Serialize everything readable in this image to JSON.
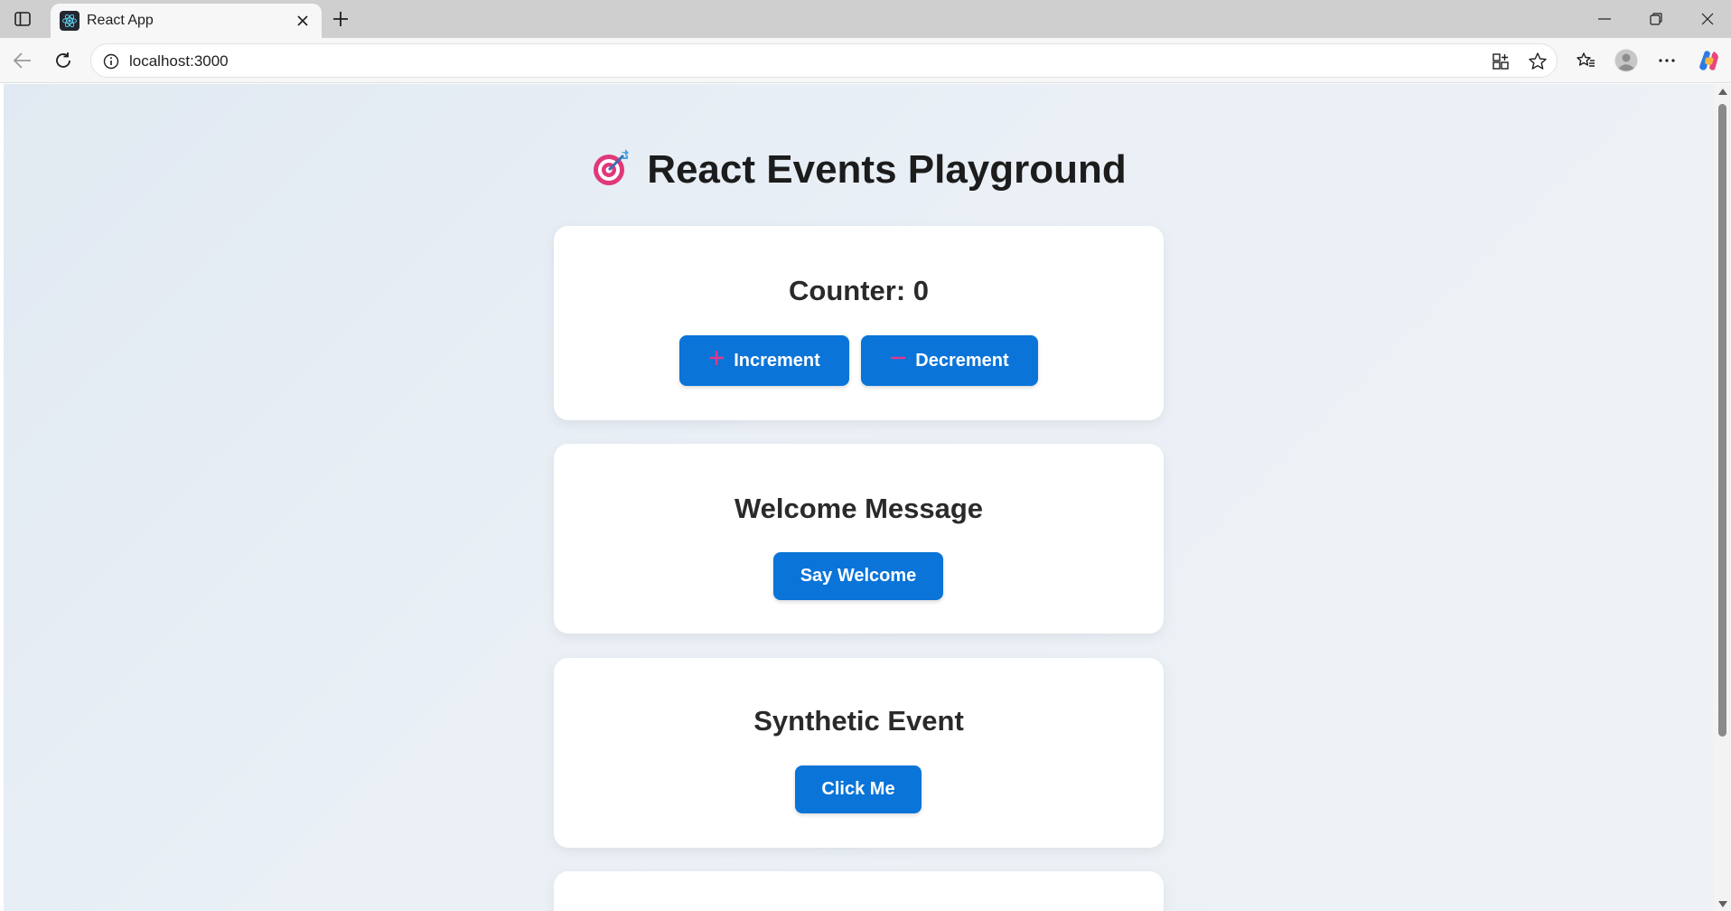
{
  "browser": {
    "tab": {
      "title": "React App",
      "favicon": "react-icon"
    },
    "url": "localhost:3000"
  },
  "page": {
    "heading": {
      "emoji": "🎯",
      "text": "React Events Playground"
    },
    "counter_card": {
      "title": "Counter: 0",
      "increment_label": "Increment",
      "decrement_label": "Decrement"
    },
    "welcome_card": {
      "title": "Welcome Message",
      "button_label": "Say Welcome"
    },
    "synthetic_card": {
      "title": "Synthetic Event",
      "button_label": "Click Me"
    }
  },
  "colors": {
    "button_bg": "#0a74d8",
    "icon_accent": "#e0388d",
    "page_bg": "#e6edf4"
  }
}
